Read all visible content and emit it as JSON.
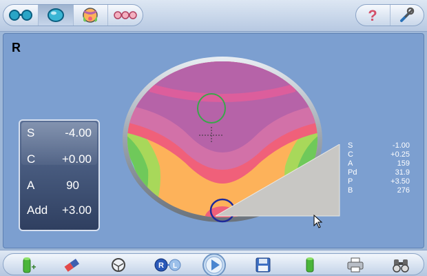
{
  "panel": {
    "eye": "R"
  },
  "lens_values": [
    {
      "label": "S",
      "value": "-4.00"
    },
    {
      "label": "C",
      "value": "+0.00"
    },
    {
      "label": "A",
      "value": "90"
    },
    {
      "label": "Add",
      "value": "+3.00"
    }
  ],
  "readout": [
    {
      "label": "S",
      "value": "-1.00"
    },
    {
      "label": "C",
      "value": "+0.25"
    },
    {
      "label": "A",
      "value": "159"
    },
    {
      "label": "Pd",
      "value": "31.9"
    },
    {
      "label": "P",
      "value": "+3.50"
    },
    {
      "label": "B",
      "value": "276"
    }
  ],
  "top_toolbar": {
    "mode_buttons": [
      "binocular-icon",
      "single-lens-icon",
      "color-map-icon",
      "multi-lens-icon"
    ],
    "help_icon": "help-icon",
    "settings_icon": "tools-icon"
  },
  "bottom_toolbar": {
    "buttons": [
      "add-lens-icon",
      "eraser-icon",
      "frame-icon",
      "right-left-icon",
      "play-icon",
      "save-icon",
      "lens-green-icon",
      "printer-icon",
      "binoculars-icon"
    ]
  },
  "colors": {
    "panel": "#7c9fd0",
    "panel_border": "#5d80b2",
    "box_bg": "#3b4c6f",
    "lens_ring": "#9aa3ad",
    "map_orange": "#fdb25a",
    "map_magenta": "#b663a8",
    "map_pink": "#f0607a",
    "map_green": "#6fc95a",
    "map_cyan": "#6fd0e8",
    "green_circle": "#3aa64a",
    "blue_circle": "#1e2a9a",
    "wedge": "#c8c7c4"
  }
}
